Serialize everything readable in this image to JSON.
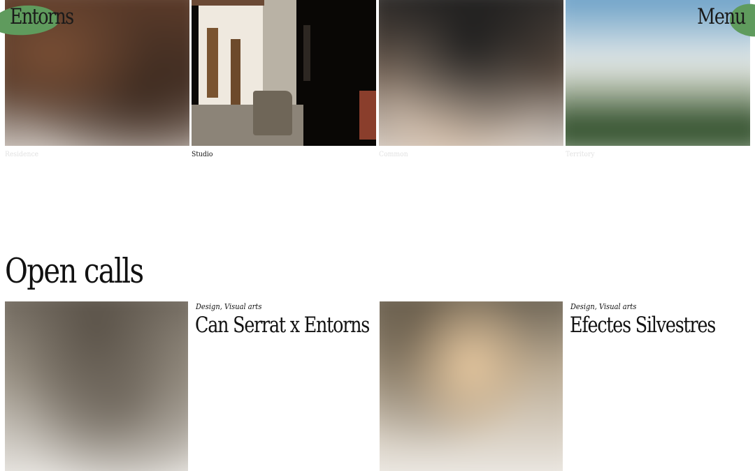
{
  "header": {
    "logo": "Entorns",
    "menu_label": "Menu"
  },
  "spaces": [
    {
      "label": "Residence",
      "faded": true
    },
    {
      "label": "Studio",
      "faded": false
    },
    {
      "label": "Common",
      "faded": true
    },
    {
      "label": "Territory",
      "faded": true
    }
  ],
  "open_calls": {
    "title": "Open calls",
    "items": [
      {
        "categories": "Design, Visual arts",
        "title": "Can Serrat x Entorns"
      },
      {
        "categories": "Design, Visual arts",
        "title": "Efectes Silvestres"
      }
    ]
  },
  "colors": {
    "accent_green": "#5f9b5d",
    "text": "#111111",
    "faded_label": "#e2e2e2"
  }
}
